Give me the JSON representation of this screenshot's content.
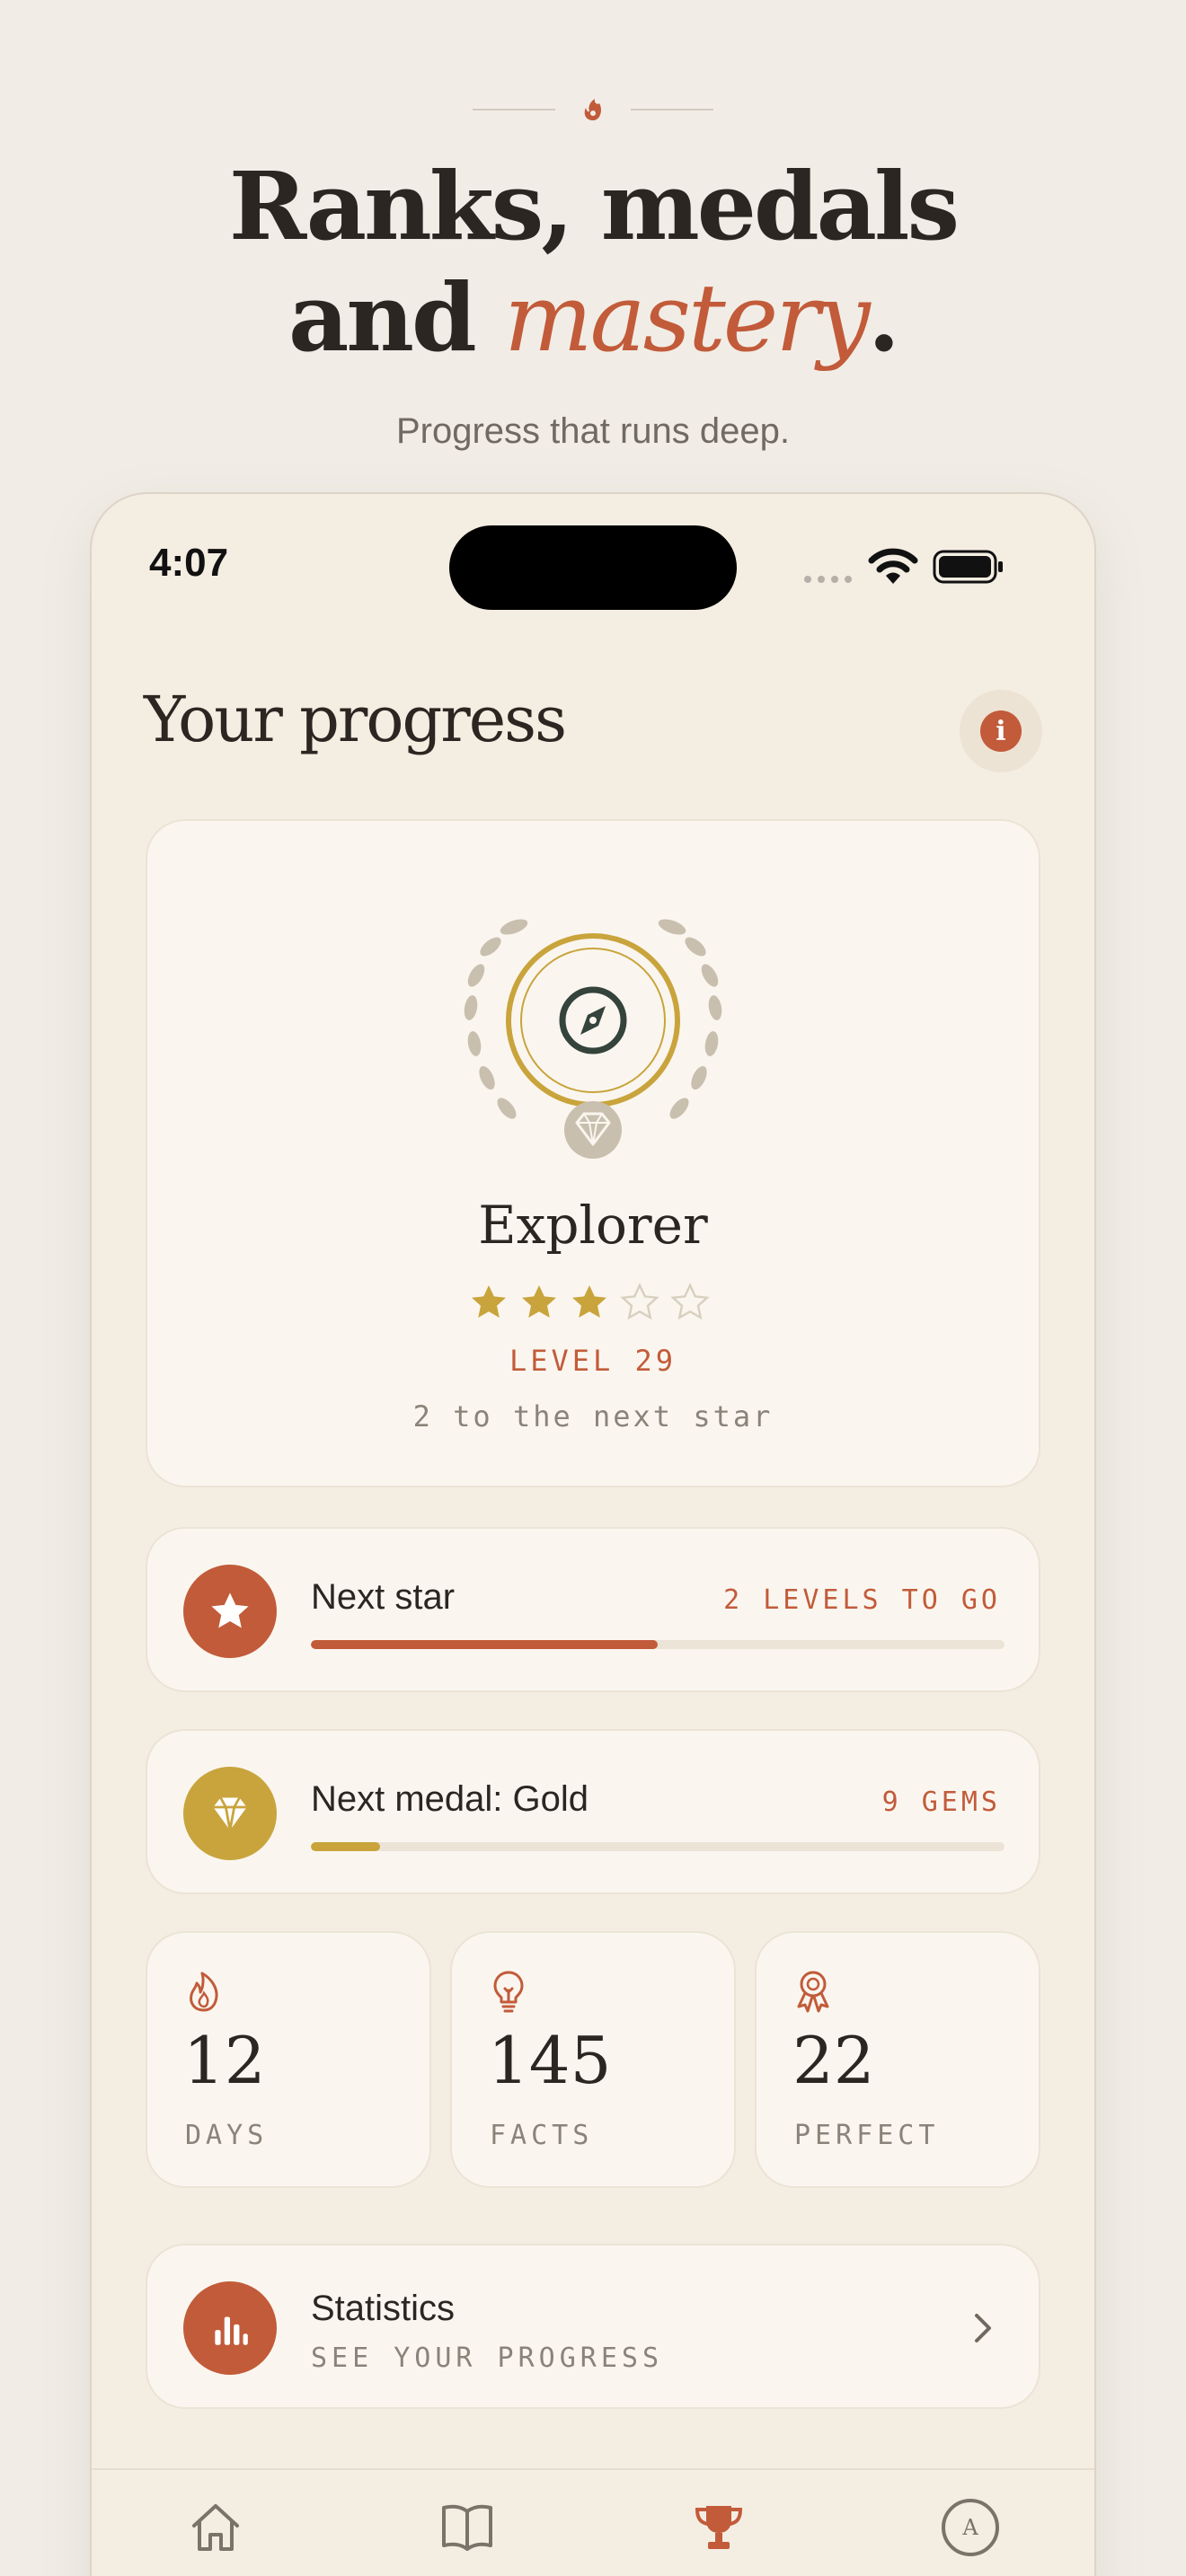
{
  "hero": {
    "title_line1": "Ranks, medals",
    "title_line2_pre": "and ",
    "title_line2_accent": "mastery",
    "title_line2_post": ".",
    "subtitle": "Progress that runs deep.",
    "ornament_icon": "flame-bloom-icon"
  },
  "status_bar": {
    "time": "4:07",
    "icons": [
      "cellular-signal-icon",
      "wifi-icon",
      "battery-icon"
    ]
  },
  "header": {
    "title": "Your progress",
    "info_glyph": "i"
  },
  "rank": {
    "emblem_icon": "compass-icon",
    "name": "Explorer",
    "stars_filled": 3,
    "stars_total": 5,
    "level_label": "LEVEL 29",
    "next_hint": "2 to the next star"
  },
  "next_star": {
    "icon": "star-icon",
    "label": "Next star",
    "right_text": "2 LEVELS TO GO",
    "progress": 0.5
  },
  "next_medal": {
    "icon": "gem-icon",
    "label": "Next medal: Gold",
    "right_text": "9 GEMS",
    "progress": 0.1
  },
  "stats": [
    {
      "icon": "flame-icon",
      "value": "12",
      "label": "DAYS"
    },
    {
      "icon": "lightbulb-icon",
      "value": "145",
      "label": "FACTS"
    },
    {
      "icon": "award-ribbon-icon",
      "value": "22",
      "label": "PERFECT"
    }
  ],
  "statistics": {
    "icon": "bar-chart-icon",
    "title": "Statistics",
    "subtitle": "SEE YOUR PROGRESS"
  },
  "tabbar": {
    "tabs": [
      {
        "icon": "home-icon",
        "active": false
      },
      {
        "icon": "book-icon",
        "active": false
      },
      {
        "icon": "trophy-icon",
        "active": true
      },
      {
        "icon": "avatar-icon",
        "active": false,
        "glyph": "A"
      }
    ]
  },
  "colors": {
    "accent": "#c25b3a",
    "gold": "#c9a43c",
    "background": "#f1ede6",
    "card": "#faf6ef"
  }
}
